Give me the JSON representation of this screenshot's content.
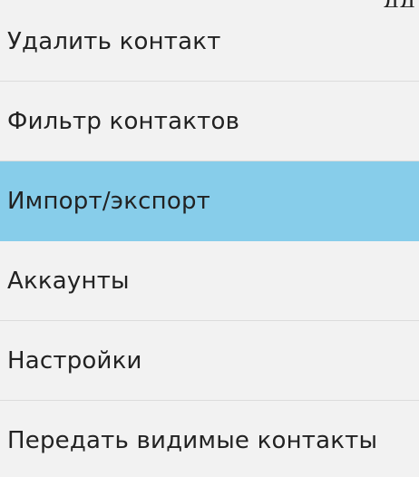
{
  "menu": {
    "partial_top_text": "дд",
    "items": [
      {
        "label": "Удалить контакт"
      },
      {
        "label": "Фильтр контактов"
      },
      {
        "label": "Импорт/экспорт"
      },
      {
        "label": "Аккаунты"
      },
      {
        "label": "Настройки"
      },
      {
        "label": "Передать видимые контакты"
      }
    ],
    "selected_index": 2,
    "colors": {
      "background": "#f2f2f2",
      "selected_background": "#87cdea",
      "divider": "#dcdcdc",
      "text": "#222222"
    }
  }
}
